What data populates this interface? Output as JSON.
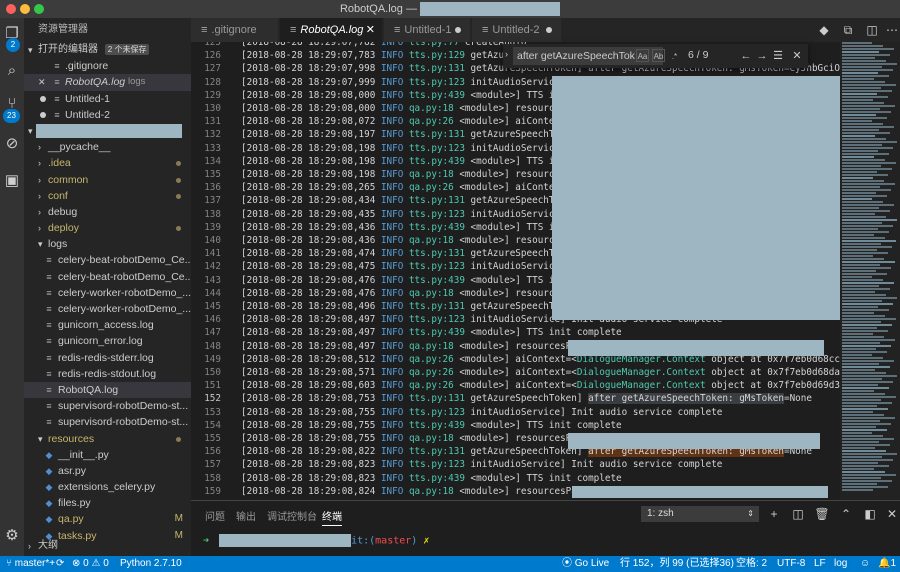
{
  "window": {
    "title": "RobotQA.log —"
  },
  "activity": {
    "explorer_badge": "2",
    "scm_badge": "23"
  },
  "sidebar": {
    "header": "资源管理器",
    "open_editors": {
      "label": "打开的编辑器",
      "unsaved": "2 个未保存"
    },
    "open_files": [
      {
        "name": ".gitignore",
        "extra": "",
        "marker": ""
      },
      {
        "name": "RobotQA.log",
        "extra": "logs",
        "marker": "close"
      },
      {
        "name": "Untitled-1",
        "extra": "",
        "marker": "dot"
      },
      {
        "name": "Untitled-2",
        "extra": "",
        "marker": "dot"
      }
    ],
    "tree": [
      {
        "name": "__pycache__",
        "kind": "folder",
        "expanded": false,
        "color": "#cccccc",
        "dot": false,
        "mod": ""
      },
      {
        "name": ".idea",
        "kind": "folder",
        "expanded": false,
        "color": "#c7b66b",
        "dot": true,
        "mod": ""
      },
      {
        "name": "common",
        "kind": "folder",
        "expanded": false,
        "color": "#c7b66b",
        "dot": true,
        "mod": ""
      },
      {
        "name": "conf",
        "kind": "folder",
        "expanded": false,
        "color": "#c7b66b",
        "dot": true,
        "mod": ""
      },
      {
        "name": "debug",
        "kind": "folder",
        "expanded": false,
        "color": "#cccccc",
        "dot": false,
        "mod": ""
      },
      {
        "name": "deploy",
        "kind": "folder",
        "expanded": false,
        "color": "#c7b66b",
        "dot": true,
        "mod": ""
      },
      {
        "name": "logs",
        "kind": "folder",
        "expanded": true,
        "color": "#cccccc",
        "dot": false,
        "mod": ""
      },
      {
        "name": "celery-beat-robotDemo_Ce...",
        "kind": "file",
        "color": "#cccccc",
        "dot": false,
        "mod": ""
      },
      {
        "name": "celery-beat-robotDemo_Ce...",
        "kind": "file",
        "color": "#cccccc",
        "dot": false,
        "mod": ""
      },
      {
        "name": "celery-worker-robotDemo_...",
        "kind": "file",
        "color": "#cccccc",
        "dot": false,
        "mod": ""
      },
      {
        "name": "celery-worker-robotDemo_...",
        "kind": "file",
        "color": "#cccccc",
        "dot": false,
        "mod": ""
      },
      {
        "name": "gunicorn_access.log",
        "kind": "file",
        "color": "#cccccc",
        "dot": false,
        "mod": ""
      },
      {
        "name": "gunicorn_error.log",
        "kind": "file",
        "color": "#cccccc",
        "dot": false,
        "mod": ""
      },
      {
        "name": "redis-redis-stderr.log",
        "kind": "file",
        "color": "#cccccc",
        "dot": false,
        "mod": ""
      },
      {
        "name": "redis-redis-stdout.log",
        "kind": "file",
        "color": "#cccccc",
        "dot": false,
        "mod": ""
      },
      {
        "name": "RobotQA.log",
        "kind": "file",
        "color": "#cccccc",
        "dot": false,
        "mod": "",
        "selected": true
      },
      {
        "name": "supervisord-robotDemo-st...",
        "kind": "file",
        "color": "#cccccc",
        "dot": false,
        "mod": ""
      },
      {
        "name": "supervisord-robotDemo-st...",
        "kind": "file",
        "color": "#cccccc",
        "dot": false,
        "mod": ""
      },
      {
        "name": "resources",
        "kind": "folder",
        "expanded": true,
        "color": "#c7b66b",
        "dot": true,
        "mod": ""
      },
      {
        "name": "__init__.py",
        "kind": "py",
        "color": "#cccccc",
        "dot": false,
        "mod": ""
      },
      {
        "name": "asr.py",
        "kind": "py",
        "color": "#cccccc",
        "dot": false,
        "mod": ""
      },
      {
        "name": "extensions_celery.py",
        "kind": "py",
        "color": "#cccccc",
        "dot": false,
        "mod": ""
      },
      {
        "name": "files.py",
        "kind": "py",
        "color": "#cccccc",
        "dot": false,
        "mod": ""
      },
      {
        "name": "qa.py",
        "kind": "py",
        "color": "#c7b66b",
        "dot": false,
        "mod": "M"
      },
      {
        "name": "tasks.py",
        "kind": "py",
        "color": "#c7b66b",
        "dot": false,
        "mod": "M"
      }
    ],
    "outline": "大纲"
  },
  "tabs": [
    {
      "label": ".gitignore",
      "state": "plain"
    },
    {
      "label": "RobotQA.log",
      "state": "active"
    },
    {
      "label": "Untitled-1",
      "state": "dirty"
    },
    {
      "label": "Untitled-2",
      "state": "dirty"
    }
  ],
  "find": {
    "query": "after getAzureSpeechTok",
    "count": "6 / 9",
    "opt_case": "Aa",
    "opt_word": "Ab",
    "opt_regex": ".*"
  },
  "editor": {
    "current_line": "152",
    "lines": [
      {
        "n": "125",
        "ts": "[2018-08-28 18:29:07,782",
        "lv": "INFO",
        "file": "tts.py:77",
        "msg": " createAudio"
      },
      {
        "n": "126",
        "ts": "[2018-08-28 18:29:07,783",
        "lv": "INFO",
        "file": "tts.py:129",
        "msg": " getAzure"
      },
      {
        "n": "127",
        "ts": "[2018-08-28 18:29:07,998",
        "lv": "INFO",
        "file": "tts.py:131",
        "msg": " getAzureSpeechToken] after getAzureSpeechToken: gMsToken=eyJhbGciOiJ"
      },
      {
        "n": "128",
        "ts": "[2018-08-28 18:29:07,999",
        "lv": "INFO",
        "file": "tts.py:123",
        "msg": " initAudioService]"
      },
      {
        "n": "129",
        "ts": "[2018-08-28 18:29:08,000",
        "lv": "INFO",
        "file": "tts.py:439",
        "msg": " <module>] TTS ini"
      },
      {
        "n": "130",
        "ts": "[2018-08-28 18:29:08,000",
        "lv": "INFO",
        "file": "qa.py:18",
        "msg": " <module>] resourcesP"
      },
      {
        "n": "131",
        "ts": "[2018-08-28 18:29:08,072",
        "lv": "INFO",
        "file": "qa.py:26",
        "msg": " <module>] aiContext="
      },
      {
        "n": "132",
        "ts": "[2018-08-28 18:29:08,197",
        "lv": "INFO",
        "file": "tts.py:131",
        "msg": " getAzureSpeechToke"
      },
      {
        "n": "133",
        "ts": "[2018-08-28 18:29:08,198",
        "lv": "INFO",
        "file": "tts.py:123",
        "msg": " initAudioService]"
      },
      {
        "n": "134",
        "ts": "[2018-08-28 18:29:08,198",
        "lv": "INFO",
        "file": "tts.py:439",
        "msg": " <module>] TTS init"
      },
      {
        "n": "135",
        "ts": "[2018-08-28 18:29:08,198",
        "lv": "INFO",
        "file": "qa.py:18",
        "msg": " <module>] resourcesP"
      },
      {
        "n": "136",
        "ts": "[2018-08-28 18:29:08,265",
        "lv": "INFO",
        "file": "qa.py:26",
        "msg": " <module>] aiContext="
      },
      {
        "n": "137",
        "ts": "[2018-08-28 18:29:08,434",
        "lv": "INFO",
        "file": "tts.py:131",
        "msg": " getAzureSpeechToke"
      },
      {
        "n": "138",
        "ts": "[2018-08-28 18:29:08,435",
        "lv": "INFO",
        "file": "tts.py:123",
        "msg": " initAudioService]"
      },
      {
        "n": "139",
        "ts": "[2018-08-28 18:29:08,436",
        "lv": "INFO",
        "file": "tts.py:439",
        "msg": " <module>] TTS init"
      },
      {
        "n": "140",
        "ts": "[2018-08-28 18:29:08,436",
        "lv": "INFO",
        "file": "qa.py:18",
        "msg": " <module>] resourcesP"
      },
      {
        "n": "141",
        "ts": "[2018-08-28 18:29:08,474",
        "lv": "INFO",
        "file": "tts.py:131",
        "msg": " getAzureSpeechToke"
      },
      {
        "n": "142",
        "ts": "[2018-08-28 18:29:08,475",
        "lv": "INFO",
        "file": "tts.py:123",
        "msg": " initAudioService]"
      },
      {
        "n": "143",
        "ts": "[2018-08-28 18:29:08,476",
        "lv": "INFO",
        "file": "tts.py:439",
        "msg": " <module>] TTS init"
      },
      {
        "n": "144",
        "ts": "[2018-08-28 18:29:08,476",
        "lv": "INFO",
        "file": "qa.py:18",
        "msg": " <module>] resourcesP"
      },
      {
        "n": "145",
        "ts": "[2018-08-28 18:29:08,496",
        "lv": "INFO",
        "file": "tts.py:131",
        "msg": " getAzureSpeechToke"
      },
      {
        "n": "146",
        "ts": "[2018-08-28 18:29:08,497",
        "lv": "INFO",
        "file": "tts.py:123",
        "msg": " initAudioService] Init audio service complete"
      },
      {
        "n": "147",
        "ts": "[2018-08-28 18:29:08,497",
        "lv": "INFO",
        "file": "tts.py:439",
        "msg": " <module>] TTS init complete"
      },
      {
        "n": "148",
        "ts": "[2018-08-28 18:29:08,497",
        "lv": "INFO",
        "file": "qa.py:18",
        "msg": " <module>] resourcesPath="
      },
      {
        "n": "149",
        "ts": "[2018-08-28 18:29:08,512",
        "lv": "INFO",
        "file": "qa.py:26",
        "msg": " <module>] aiContext=<",
        "cls": "DialogueManager.Context",
        "tail": " object at 0x7f7eb0d68cc0>"
      },
      {
        "n": "150",
        "ts": "[2018-08-28 18:29:08,571",
        "lv": "INFO",
        "file": "qa.py:26",
        "msg": " <module>] aiContext=<",
        "cls": "DialogueManager.Context",
        "tail": " object at 0x7f7eb0d68da0>"
      },
      {
        "n": "151",
        "ts": "[2018-08-28 18:29:08,603",
        "lv": "INFO",
        "file": "qa.py:26",
        "msg": " <module>] aiContext=<",
        "cls": "DialogueManager.Context",
        "tail": " object at 0x7f7eb0d69d30>"
      },
      {
        "n": "152",
        "ts": "[2018-08-28 18:29:08,753",
        "lv": "INFO",
        "file": "tts.py:131",
        "msg": " getAzureSpeechToken] ",
        "hl": "after getAzureSpeechToken: gMsToken",
        "tail": "=None"
      },
      {
        "n": "153",
        "ts": "[2018-08-28 18:29:08,755",
        "lv": "INFO",
        "file": "tts.py:123",
        "msg": " initAudioService] Init audio service complete"
      },
      {
        "n": "154",
        "ts": "[2018-08-28 18:29:08,755",
        "lv": "INFO",
        "file": "tts.py:439",
        "msg": " <module>] TTS init complete"
      },
      {
        "n": "155",
        "ts": "[2018-08-28 18:29:08,755",
        "lv": "INFO",
        "file": "qa.py:18",
        "msg": " <module>] resourcesPath"
      },
      {
        "n": "156",
        "ts": "[2018-08-28 18:29:08,822",
        "lv": "INFO",
        "file": "tts.py:131",
        "msg": " getAzureSpeechToken] ",
        "match": "after getAzureSpeechToken: gMsToken",
        "tail": "=None"
      },
      {
        "n": "157",
        "ts": "[2018-08-28 18:29:08,823",
        "lv": "INFO",
        "file": "tts.py:123",
        "msg": " initAudioService] Init audio service complete"
      },
      {
        "n": "158",
        "ts": "[2018-08-28 18:29:08,823",
        "lv": "INFO",
        "file": "tts.py:439",
        "msg": " <module>] TTS init complete"
      },
      {
        "n": "159",
        "ts": "[2018-08-28 18:29:08,824",
        "lv": "INFO",
        "file": "qa.py:18",
        "msg": " <module>] resourcesPath="
      }
    ]
  },
  "panel": {
    "tabs": [
      "问题",
      "输出",
      "调试控制台",
      "终端"
    ],
    "active_tab": "终端",
    "terminal_select": "1: zsh",
    "prompt_arrow": "➜",
    "prompt_git": "it:(",
    "prompt_branch": "master",
    "prompt_close": ")",
    "prompt_x": "✗"
  },
  "status": {
    "branch": "master*+",
    "errors": "0",
    "warnings": "0",
    "python": "Python 2.7.10",
    "golive": "Go Live",
    "position": "行 152，列 99 (已选择36)",
    "indent": "空格: 2",
    "encoding": "UTF-8",
    "eol": "LF",
    "language": "log",
    "notifications": "1"
  },
  "colors": {
    "accent": "#007acc",
    "redaction": "#9eb5c2"
  }
}
